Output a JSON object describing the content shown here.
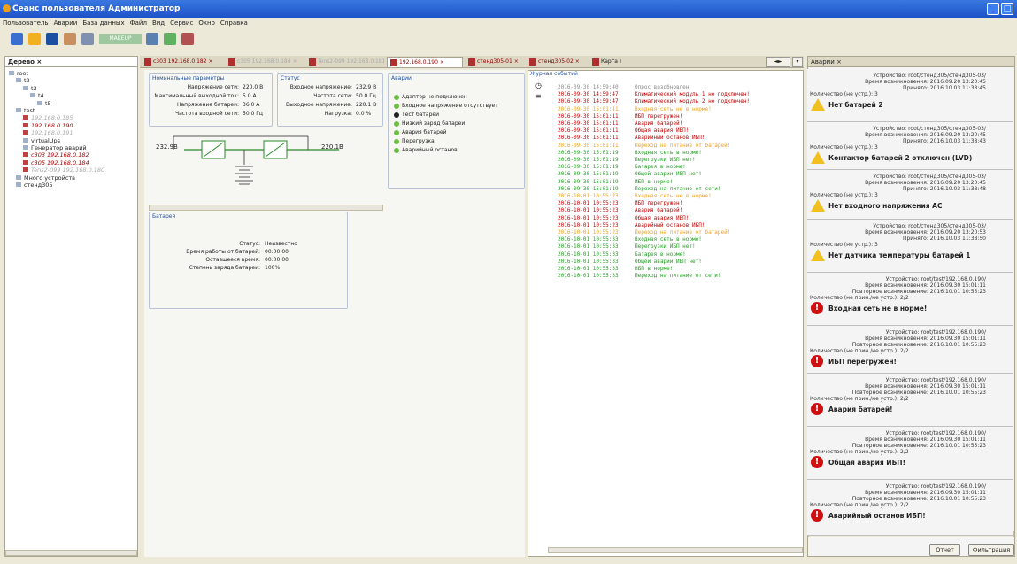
{
  "window": {
    "title": "Сеанс пользователя Администратор"
  },
  "menu": [
    "Пользователь",
    "Аварии",
    "База данных",
    "Файл",
    "Вид",
    "Сервис",
    "Окно",
    "Справка"
  ],
  "toolbar": {
    "combo": "MAKEUP"
  },
  "tree": {
    "title": "Дерево",
    "items": [
      {
        "label": "root",
        "level": 0,
        "style": "normal"
      },
      {
        "label": "t2",
        "level": 1,
        "style": "normal"
      },
      {
        "label": "t3",
        "level": 2,
        "style": "normal"
      },
      {
        "label": "t4",
        "level": 3,
        "style": "normal"
      },
      {
        "label": "t5",
        "level": 4,
        "style": "normal"
      },
      {
        "label": "test",
        "level": 1,
        "style": "normal"
      },
      {
        "label": "192.168.0.185",
        "level": 2,
        "style": "gray"
      },
      {
        "label": "192.168.0.190",
        "level": 2,
        "style": "red"
      },
      {
        "label": "192.168.0.191",
        "level": 2,
        "style": "gray"
      },
      {
        "label": "virtualUps",
        "level": 2,
        "style": "normal"
      },
      {
        "label": "Генератор аварий",
        "level": 2,
        "style": "normal"
      },
      {
        "label": "с303 192.168.0.182",
        "level": 2,
        "style": "red"
      },
      {
        "label": "с305 192.168.0.184",
        "level": 2,
        "style": "red"
      },
      {
        "label": "Tens2-099 192.168.0.180",
        "level": 2,
        "style": "gray"
      },
      {
        "label": "Много устройств",
        "level": 1,
        "style": "normal"
      },
      {
        "label": "стенд305",
        "level": 1,
        "style": "normal"
      }
    ]
  },
  "tabs": [
    {
      "label": "с303 192.168.0.182",
      "style": "red"
    },
    {
      "label": "с305 192.168.0.184",
      "style": "gray"
    },
    {
      "label": "Tens2-099 192.168.0.181",
      "style": "gray"
    },
    {
      "label": "192.168.0.190",
      "style": "red",
      "active": true
    },
    {
      "label": "стенд305-01",
      "style": "red"
    },
    {
      "label": "стенд305-02",
      "style": "red"
    },
    {
      "label": "Карта",
      "style": "normal"
    }
  ],
  "nominal": {
    "title": "Номинальные параметры",
    "rows": [
      {
        "k": "Напряжение сети:",
        "v": "220.0 В"
      },
      {
        "k": "Максимальный выходной ток:",
        "v": "5.0 А"
      },
      {
        "k": "Напряжение батареи:",
        "v": "36.0 А"
      },
      {
        "k": "Частота входной сети:",
        "v": "50.0 Гц"
      }
    ]
  },
  "status": {
    "title": "Статус",
    "rows": [
      {
        "k": "Входное напряжение:",
        "v": "232.9 В"
      },
      {
        "k": "Частота сети:",
        "v": "50.0 Гц"
      },
      {
        "k": "Выходное напряжение:",
        "v": "220.1 В"
      },
      {
        "k": "Нагрузка:",
        "v": "0.0 %"
      }
    ]
  },
  "diagram": {
    "vin": "232.9В",
    "vout": "220.1В"
  },
  "alarms": {
    "title": "Аварии",
    "items": [
      {
        "label": "Адаптер не подключен",
        "color": "green"
      },
      {
        "label": "Входное напряжение отсутствует",
        "color": "green"
      },
      {
        "label": "Тест батарей",
        "color": "black"
      },
      {
        "label": "Низкий заряд батареи",
        "color": "green"
      },
      {
        "label": "Авария батарей",
        "color": "green"
      },
      {
        "label": "Перегрузка",
        "color": "green"
      },
      {
        "label": "Аварийный останов",
        "color": "green"
      }
    ]
  },
  "battery": {
    "title": "Батарея",
    "rows": [
      {
        "k": "Статус:",
        "v": "Неизвестно"
      },
      {
        "k": "Время работы от батарей:",
        "v": "00:00:00"
      },
      {
        "k": "Оставшееся время:",
        "v": "00:00:00"
      },
      {
        "k": "Степень заряда батареи:",
        "v": "100%"
      }
    ]
  },
  "log": {
    "title": "Журнал событий",
    "entries": [
      {
        "t": "2016-09-30 14:59:40",
        "m": "Опрос возобновлен",
        "c": "#888888"
      },
      {
        "t": "2016-09-30 14:59:47",
        "m": "Климатический модуль 1 не подключен!",
        "c": "#c00000"
      },
      {
        "t": "2016-09-30 14:59:47",
        "m": "Климатический модуль 2 не подключен!",
        "c": "#c00000"
      },
      {
        "t": "2016-09-30 15:01:11",
        "m": "Входная сеть не в норме!",
        "c": "#f0a020"
      },
      {
        "t": "2016-09-30 15:01:11",
        "m": "ИБП перегружен!",
        "c": "#c00000"
      },
      {
        "t": "2016-09-30 15:01:11",
        "m": "Авария батарей!",
        "c": "#c00000"
      },
      {
        "t": "2016-09-30 15:01:11",
        "m": "Общая авария ИБП!",
        "c": "#c00000"
      },
      {
        "t": "2016-09-30 15:01:11",
        "m": "Аварийный останов ИБП!",
        "c": "#c00000"
      },
      {
        "t": "2016-09-30 15:01:11",
        "m": "Переход на питание от батарей!",
        "c": "#f0a020"
      },
      {
        "t": "2016-09-30 15:01:19",
        "m": "Входная сеть в норме!",
        "c": "#20a020"
      },
      {
        "t": "2016-09-30 15:01:19",
        "m": "Перегрузки ИБП нет!",
        "c": "#20a020"
      },
      {
        "t": "2016-09-30 15:01:19",
        "m": "Батарея в норме!",
        "c": "#20a020"
      },
      {
        "t": "2016-09-30 15:01:19",
        "m": "Общей аварии ИБП нет!",
        "c": "#20a020"
      },
      {
        "t": "2016-09-30 15:01:19",
        "m": "ИБП в норме!",
        "c": "#20a020"
      },
      {
        "t": "2016-09-30 15:01:19",
        "m": "Переход на питание от сети!",
        "c": "#20a020"
      },
      {
        "t": "2016-10-01 10:55:23",
        "m": "Входная сеть не в норме!",
        "c": "#f0a020"
      },
      {
        "t": "2016-10-01 10:55:23",
        "m": "ИБП перегружен!",
        "c": "#c00000"
      },
      {
        "t": "2016-10-01 10:55:23",
        "m": "Авария батарей!",
        "c": "#c00000"
      },
      {
        "t": "2016-10-01 10:55:23",
        "m": "Общая авария ИБП!",
        "c": "#c00000"
      },
      {
        "t": "2016-10-01 10:55:23",
        "m": "Аварийный останов ИБП!",
        "c": "#c00000"
      },
      {
        "t": "2016-10-01 10:55:23",
        "m": "Переход на питание от батарей!",
        "c": "#f0a020"
      },
      {
        "t": "2016-10-01 10:55:33",
        "m": "Входная сеть в норме!",
        "c": "#20a020"
      },
      {
        "t": "2016-10-01 10:55:33",
        "m": "Перегрузки ИБП нет!",
        "c": "#20a020"
      },
      {
        "t": "2016-10-01 10:55:33",
        "m": "Батарея в норме!",
        "c": "#20a020"
      },
      {
        "t": "2016-10-01 10:55:33",
        "m": "Общей аварии ИБП нет!",
        "c": "#20a020"
      },
      {
        "t": "2016-10-01 10:55:33",
        "m": "ИБП в норме!",
        "c": "#20a020"
      },
      {
        "t": "2016-10-01 10:55:33",
        "m": "Переход на питание от сети!",
        "c": "#20a020"
      }
    ]
  },
  "alarmsPanel": {
    "title": "Аварии",
    "cards": [
      {
        "icon": "warn",
        "lines": [
          "Устройство: root/стенд305/стенд305-03/",
          "Время возникновения: 2016.09.20 13:20:45",
          "Принято: 2016.10.03 11:38:45",
          "Количество (не устр.): 3"
        ],
        "title": "Нет батарей 2"
      },
      {
        "icon": "warn",
        "lines": [
          "Устройство: root/стенд305/стенд305-03/",
          "Время возникновения: 2016.09.20 13:20:45",
          "Принято: 2016.10.03 11:38:43",
          "Количество (не устр.): 3"
        ],
        "title": "Контактор батарей 2 отключен (LVD)"
      },
      {
        "icon": "warn",
        "lines": [
          "Устройство: root/стенд305/стенд305-03/",
          "Время возникновения: 2016.09.20 13:20:45",
          "Принято: 2016.10.03 11:38:48",
          "Количество (не устр.): 3"
        ],
        "title": "Нет входного напряжения АС"
      },
      {
        "icon": "warn",
        "lines": [
          "Устройство: root/стенд305/стенд305-03/",
          "Время возникновения: 2016.09.20 13:20:53",
          "Принято: 2016.10.03 11:38:50",
          "Количество (не устр.): 3"
        ],
        "title": "Нет датчика температуры батарей 1"
      },
      {
        "icon": "err",
        "lines": [
          "Устройство: root/test/192.168.0.190/",
          "Время возникновения: 2016.09.30 15:01:11",
          "Повторное возникновение: 2016.10.01 10:55:23",
          "Количество (не прин./не устр.): 2/2"
        ],
        "title": "Входная сеть не в норме!"
      },
      {
        "icon": "err",
        "lines": [
          "Устройство: root/test/192.168.0.190/",
          "Время возникновения: 2016.09.30 15:01:11",
          "Повторное возникновение: 2016.10.01 10:55:23",
          "Количество (не прин./не устр.): 2/2"
        ],
        "title": "ИБП перегружен!"
      },
      {
        "icon": "err",
        "lines": [
          "Устройство: root/test/192.168.0.190/",
          "Время возникновения: 2016.09.30 15:01:11",
          "Повторное возникновение: 2016.10.01 10:55:23",
          "Количество (не прин./не устр.): 2/2"
        ],
        "title": "Авария батарей!"
      },
      {
        "icon": "err",
        "lines": [
          "Устройство: root/test/192.168.0.190/",
          "Время возникновения: 2016.09.30 15:01:11",
          "Повторное возникновение: 2016.10.01 10:55:23",
          "Количество (не прин./не устр.): 2/2"
        ],
        "title": "Общая авария ИБП!"
      },
      {
        "icon": "err",
        "lines": [
          "Устройство: root/test/192.168.0.190/",
          "Время возникновения: 2016.09.30 15:01:11",
          "Повторное возникновение: 2016.10.01 10:55:23",
          "Количество (не прин./не устр.): 2/2"
        ],
        "title": "Аварийный останов ИБП!"
      }
    ],
    "buttons": {
      "report": "Отчет",
      "filter": "Фильтрация"
    }
  }
}
